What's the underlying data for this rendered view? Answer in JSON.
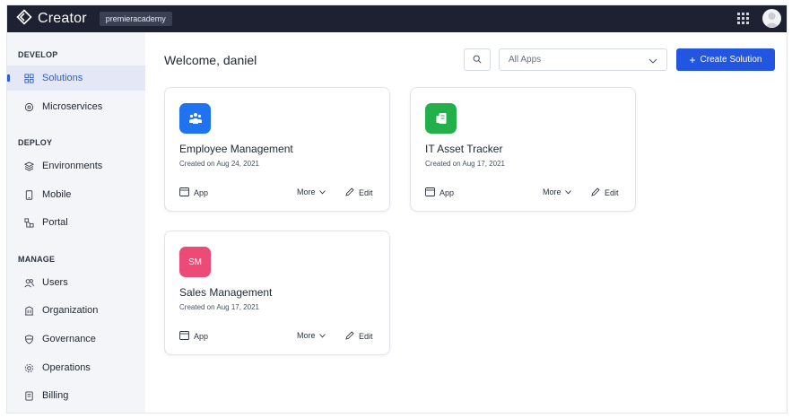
{
  "topbar": {
    "brand": "Creator",
    "workspace": "premieracademy",
    "icons": {
      "logo": "creator-logo-icon",
      "apps": "apps-grid-icon",
      "avatar": "user-avatar-icon"
    }
  },
  "sidebar": {
    "sections": [
      {
        "label": "DEVELOP",
        "items": [
          {
            "label": "Solutions",
            "icon": "grid-squares-icon",
            "active": true
          },
          {
            "label": "Microservices",
            "icon": "microservice-icon",
            "active": false
          }
        ]
      },
      {
        "label": "DEPLOY",
        "items": [
          {
            "label": "Environments",
            "icon": "layers-icon",
            "active": false
          },
          {
            "label": "Mobile",
            "icon": "mobile-icon",
            "active": false
          },
          {
            "label": "Portal",
            "icon": "portal-icon",
            "active": false
          }
        ]
      },
      {
        "label": "MANAGE",
        "items": [
          {
            "label": "Users",
            "icon": "users-icon",
            "active": false
          },
          {
            "label": "Organization",
            "icon": "organization-icon",
            "active": false
          },
          {
            "label": "Governance",
            "icon": "shield-icon",
            "active": false
          },
          {
            "label": "Operations",
            "icon": "gear-icon",
            "active": false
          },
          {
            "label": "Billing",
            "icon": "billing-icon",
            "active": false
          }
        ]
      }
    ]
  },
  "main": {
    "welcome": "Welcome, daniel",
    "filter": {
      "selected": "All Apps"
    },
    "create_button": "Create Solution",
    "cards": [
      {
        "title": "Employee Management",
        "date": "Created on Aug 24, 2021",
        "icon": "people-icon",
        "icon_color": "#1f73f0",
        "app_label": "App",
        "more_label": "More",
        "edit_label": "Edit"
      },
      {
        "title": "IT Asset Tracker",
        "date": "Created on Aug 17, 2021",
        "icon": "asset-icon",
        "icon_color": "#22b04b",
        "app_label": "App",
        "more_label": "More",
        "edit_label": "Edit"
      },
      {
        "title": "Sales Management",
        "date": "Created on Aug 17, 2021",
        "icon_text": "SM",
        "icon_color": "#ec4a77",
        "app_label": "App",
        "more_label": "More",
        "edit_label": "Edit"
      }
    ]
  },
  "colors": {
    "accent": "#2356e0",
    "topbar": "#1d2132",
    "sidebar": "#f4f5f9"
  }
}
